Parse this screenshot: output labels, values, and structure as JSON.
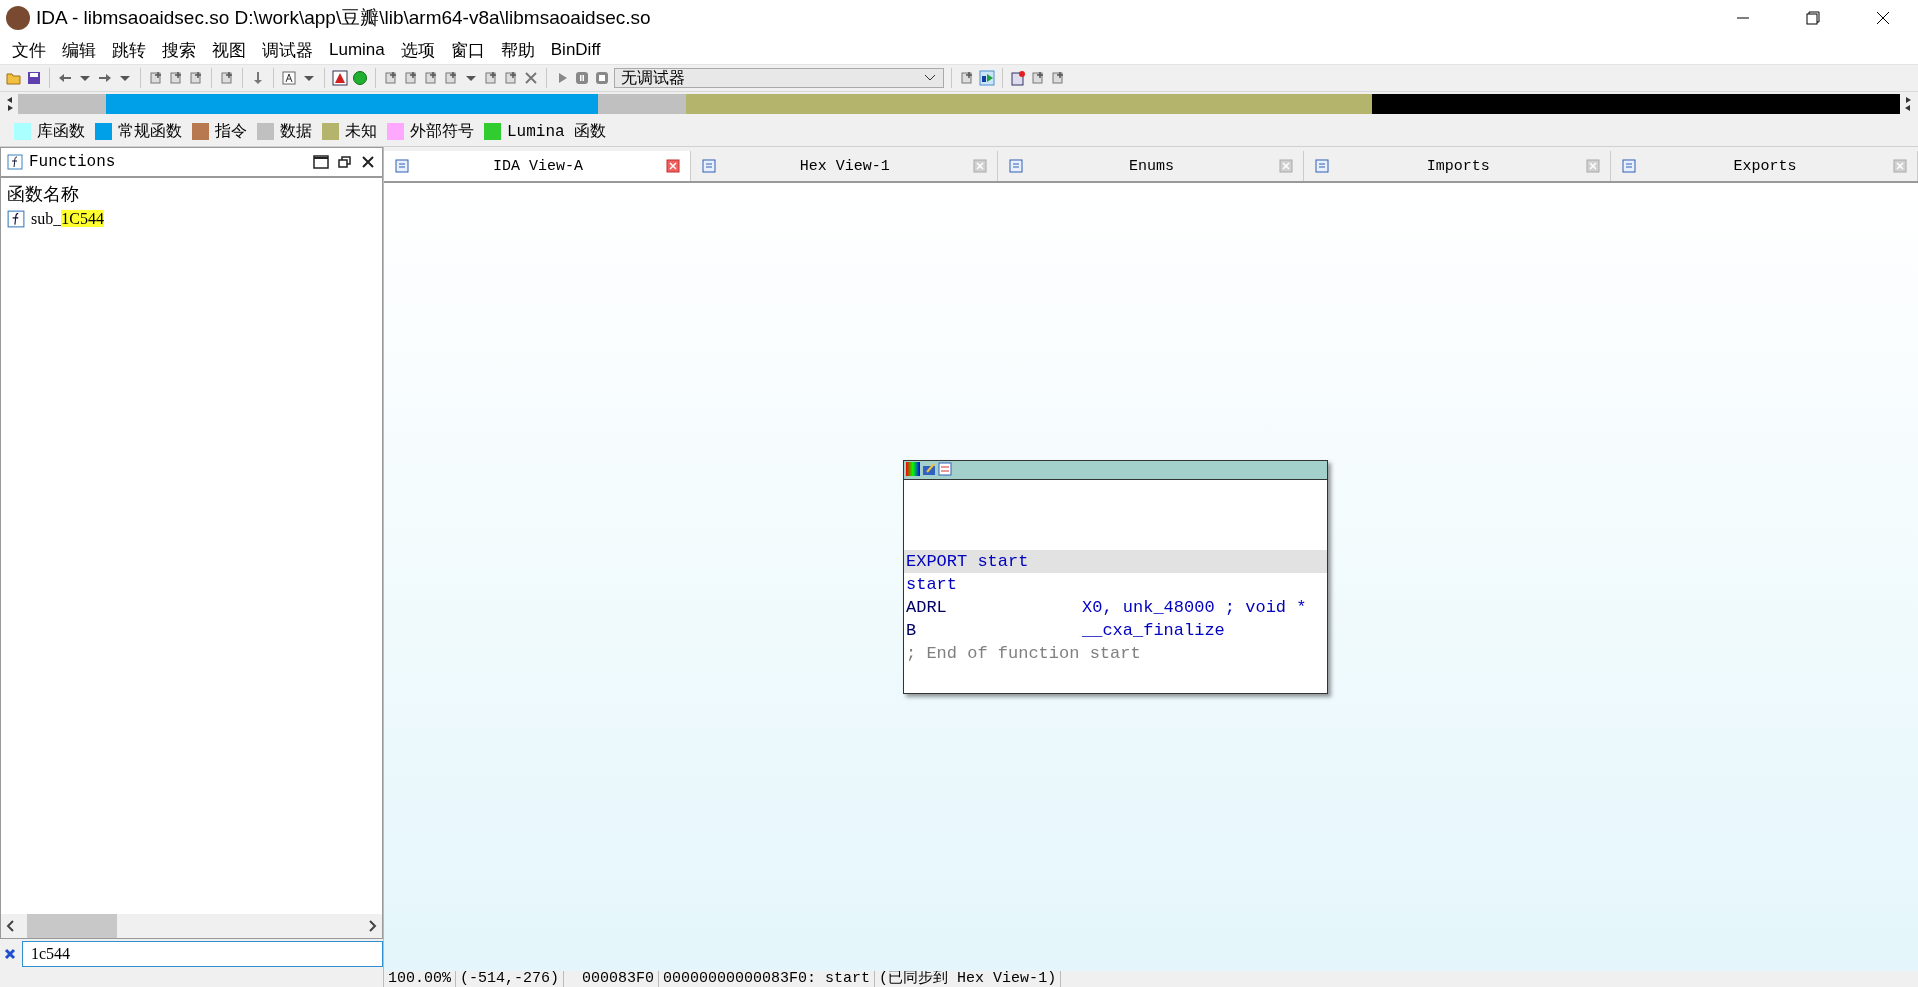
{
  "window": {
    "title": "IDA - libmsaoaidsec.so D:\\work\\app\\豆瓣\\lib\\arm64-v8a\\libmsaoaidsec.so"
  },
  "menu": [
    "文件",
    "编辑",
    "跳转",
    "搜索",
    "视图",
    "调试器",
    "Lumina",
    "选项",
    "窗口",
    "帮助",
    "BinDiff"
  ],
  "toolbar": {
    "debugger_select": "无调试器"
  },
  "legend": [
    {
      "label": "库函数",
      "color": "#aaffff"
    },
    {
      "label": "常规函数",
      "color": "#00a0e8"
    },
    {
      "label": "指令",
      "color": "#b87850"
    },
    {
      "label": "数据",
      "color": "#c0c0c0"
    },
    {
      "label": "未知",
      "color": "#b4b46c"
    },
    {
      "label": "外部符号",
      "color": "#ffa8ff"
    },
    {
      "label": "Lumina 函数",
      "color": "#30cc30"
    }
  ],
  "functions_panel": {
    "title": "Functions",
    "column": "函数名称",
    "items": [
      {
        "prefix": "sub_",
        "match": "1C544"
      }
    ],
    "filter": "1c544"
  },
  "tabs": [
    {
      "label": "IDA View-A",
      "selected": true
    },
    {
      "label": "Hex View-1",
      "selected": false
    },
    {
      "label": "Enums",
      "selected": false
    },
    {
      "label": "Imports",
      "selected": false
    },
    {
      "label": "Exports",
      "selected": false
    }
  ],
  "graph_node": {
    "lines": [
      {
        "kind": "label",
        "text": "EXPORT start",
        "selected": true
      },
      {
        "kind": "label",
        "text": "start",
        "selected": false
      },
      {
        "kind": "insn",
        "mnemonic": "ADRL",
        "operands": "X0, unk_48000",
        "comment": "; void *"
      },
      {
        "kind": "insn",
        "mnemonic": "B",
        "operands": "__cxa_finalize"
      },
      {
        "kind": "comment",
        "text": "; End of function start"
      }
    ]
  },
  "status_bar": [
    "100.00%",
    "(-514,-276)",
    "000083F0",
    "00000000000083F0: start",
    "(已同步到 Hex View-1)"
  ]
}
